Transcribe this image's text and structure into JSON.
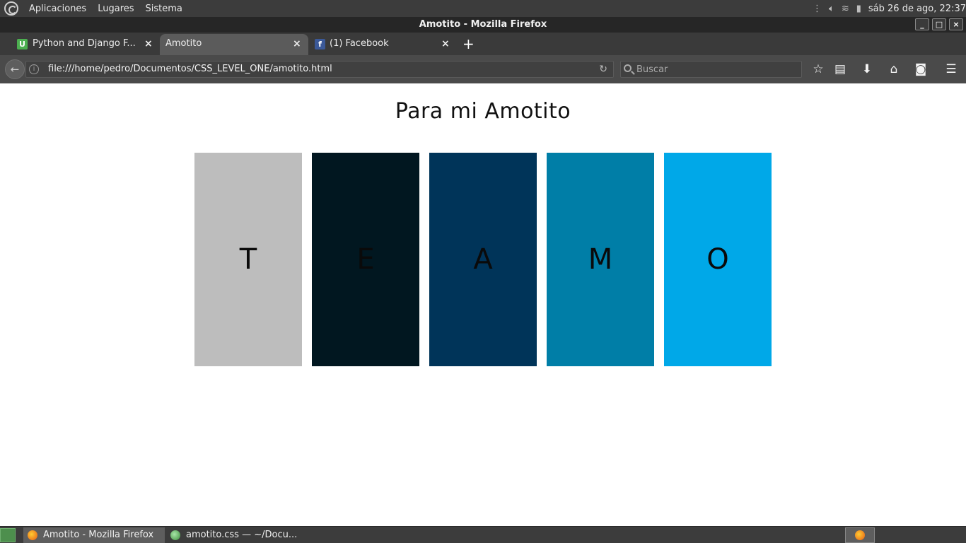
{
  "top_panel": {
    "menus": [
      "Aplicaciones",
      "Lugares",
      "Sistema"
    ],
    "clock": "sáb 26 de ago, 22:37"
  },
  "window": {
    "title": "Amotito - Mozilla Firefox",
    "buttons": [
      "_",
      "□",
      "×"
    ]
  },
  "tabs": [
    {
      "title": "Python and Django F...",
      "favicon": "U",
      "favicon_color": "#4caf50",
      "active": false
    },
    {
      "title": "Amotito",
      "favicon": "",
      "active": true
    },
    {
      "title": "(1) Facebook",
      "favicon": "f",
      "favicon_color": "#3b5998",
      "active": false
    }
  ],
  "navbar": {
    "url": "file:///home/pedro/Documentos/CSS_LEVEL_ONE/amotito.html",
    "search_placeholder": "Buscar"
  },
  "page": {
    "title": "Para mi Amotito",
    "panels": [
      {
        "letter": "T",
        "color": "#bdbdbd"
      },
      {
        "letter": "E",
        "color": "#011720"
      },
      {
        "letter": "A",
        "color": "#003459"
      },
      {
        "letter": "M",
        "color": "#007ea7"
      },
      {
        "letter": "O",
        "color": "#00a8e8"
      }
    ]
  },
  "taskbar": {
    "items": [
      {
        "label": "Amotito - Mozilla Firefox",
        "active": true
      },
      {
        "label": "amotito.css — ~/Docu...",
        "active": false
      }
    ]
  }
}
